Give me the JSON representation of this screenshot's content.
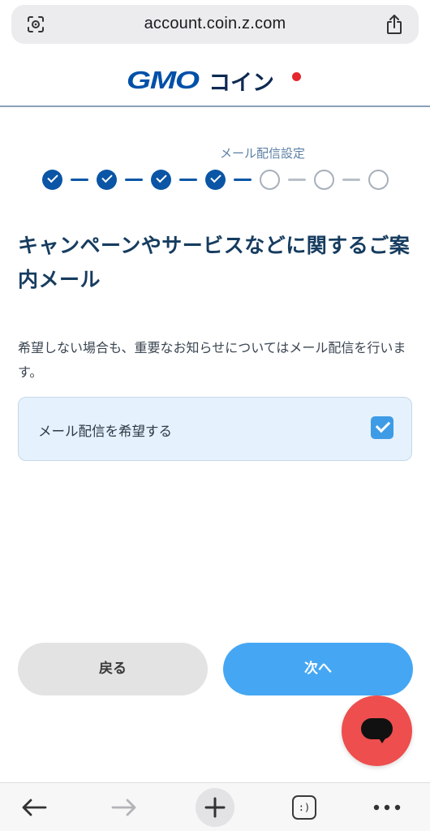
{
  "browser": {
    "url": "account.coin.z.com",
    "icons": {
      "left": "scan-icon",
      "right": "share-icon"
    }
  },
  "header": {
    "logo_primary": "GMO",
    "logo_secondary": "コイン",
    "brand_colors": {
      "blue": "#0050a8",
      "navy": "#0d2a52",
      "red": "#e5282d"
    }
  },
  "stepper": {
    "current_label": "メール配信設定",
    "total_steps": 7,
    "completed_steps": 4,
    "colors": {
      "done": "#0a55a5",
      "todo": "#a7b0ba"
    }
  },
  "main": {
    "title": "キャンペーンやサービスなどに関するご案内メール",
    "description": "希望しない場合も、重要なお知らせについてはメール配信を行います。",
    "option": {
      "label": "メール配信を希望する",
      "checked": true
    }
  },
  "buttons": {
    "back_label": "戻る",
    "next_label": "次へ"
  },
  "chat": {
    "icon": "chat-icon",
    "color": "#ee4e4e"
  },
  "toolbar": {
    "tabs_label": ":)",
    "icons": [
      "back-arrow-icon",
      "forward-arrow-icon",
      "plus-icon",
      "tabs-icon",
      "more-icon"
    ]
  }
}
